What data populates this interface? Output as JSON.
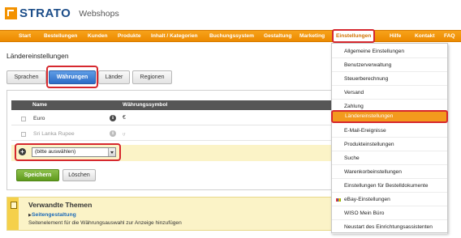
{
  "header": {
    "brand": "STRATO",
    "product": "Webshops"
  },
  "nav": {
    "items": [
      "Start",
      "Bestellungen",
      "Kunden",
      "Produkte",
      "Inhalt / Kategorien",
      "Buchungssystem",
      "Gestaltung",
      "Marketing",
      "Einstellungen",
      "Hilfe",
      "Kontakt",
      "FAQ"
    ],
    "active": "Einstellungen"
  },
  "page": {
    "title": "Ländereinstellungen"
  },
  "tabs": [
    "Sprachen",
    "Währungen",
    "Länder",
    "Regionen"
  ],
  "active_tab": "Währungen",
  "table": {
    "columns": [
      "Name",
      "Währungssymbol"
    ],
    "rows": [
      {
        "name": "Euro",
        "symbol": "€",
        "muted": false
      },
      {
        "name": "Sri Lanka Rupee",
        "symbol": "ர",
        "muted": true
      }
    ]
  },
  "add_select": {
    "value": "(bitte auswählen)"
  },
  "buttons": {
    "save": "Speichern",
    "delete": "Löschen"
  },
  "related": {
    "title": "Verwandte Themen",
    "link": "Seitengestaltung",
    "description": "Seitenelement für die Währungsauswahl zur Anzeige hinzufügen"
  },
  "dropdown": {
    "items": [
      "Allgemeine Einstellungen",
      "Benutzerverwaltung",
      "Steuerberechnung",
      "Versand",
      "Zahlung",
      "Ländereinstellungen",
      "E-Mail-Ereignisse",
      "Produkteinstellungen",
      "Suche",
      "Warenkorbeinstellungen",
      "Einstellungen für Bestelldokumente",
      "eBay-Einstellungen",
      "WISO Mein Büro",
      "Neustart des Einrichtungsassistenten"
    ],
    "active": "Ländereinstellungen"
  },
  "colors": {
    "accent": "#f39200",
    "brand_blue": "#1d4e89",
    "highlight_red": "#d6282e",
    "active_tab_blue": "#2c6cc6",
    "save_green": "#5e9a1c"
  }
}
